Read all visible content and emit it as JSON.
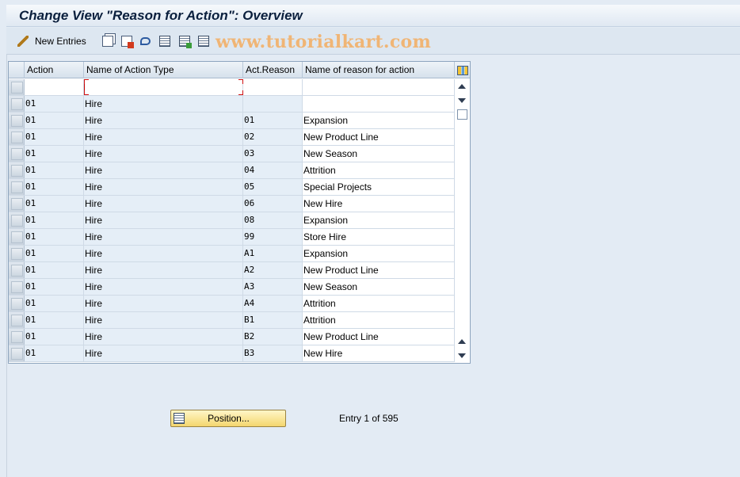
{
  "window": {
    "title": "Change View \"Reason for Action\": Overview"
  },
  "toolbar": {
    "new_entries_label": "New Entries",
    "icons": [
      "edit-toggle-icon",
      "copy-icon",
      "delete-icon",
      "undo-icon",
      "select-all-icon",
      "select-block-icon",
      "deselect-all-icon"
    ]
  },
  "watermark": "www.tutorialkart.com",
  "table": {
    "columns": [
      "Action",
      "Name of Action Type",
      "Act.Reason",
      "Name of reason for action"
    ],
    "rows": [
      {
        "action": "",
        "action_type": "",
        "reason": "",
        "reason_name": ""
      },
      {
        "action": "01",
        "action_type": "Hire",
        "reason": "",
        "reason_name": ""
      },
      {
        "action": "01",
        "action_type": "Hire",
        "reason": "01",
        "reason_name": "Expansion"
      },
      {
        "action": "01",
        "action_type": "Hire",
        "reason": "02",
        "reason_name": "New Product Line"
      },
      {
        "action": "01",
        "action_type": "Hire",
        "reason": "03",
        "reason_name": "New Season"
      },
      {
        "action": "01",
        "action_type": "Hire",
        "reason": "04",
        "reason_name": "Attrition"
      },
      {
        "action": "01",
        "action_type": "Hire",
        "reason": "05",
        "reason_name": "Special Projects"
      },
      {
        "action": "01",
        "action_type": "Hire",
        "reason": "06",
        "reason_name": "New Hire"
      },
      {
        "action": "01",
        "action_type": "Hire",
        "reason": "08",
        "reason_name": "Expansion"
      },
      {
        "action": "01",
        "action_type": "Hire",
        "reason": "99",
        "reason_name": "Store Hire"
      },
      {
        "action": "01",
        "action_type": "Hire",
        "reason": "A1",
        "reason_name": "Expansion"
      },
      {
        "action": "01",
        "action_type": "Hire",
        "reason": "A2",
        "reason_name": "New Product Line"
      },
      {
        "action": "01",
        "action_type": "Hire",
        "reason": "A3",
        "reason_name": "New Season"
      },
      {
        "action": "01",
        "action_type": "Hire",
        "reason": "A4",
        "reason_name": "Attrition"
      },
      {
        "action": "01",
        "action_type": "Hire",
        "reason": "B1",
        "reason_name": "Attrition"
      },
      {
        "action": "01",
        "action_type": "Hire",
        "reason": "B2",
        "reason_name": "New Product Line"
      },
      {
        "action": "01",
        "action_type": "Hire",
        "reason": "B3",
        "reason_name": "New Hire"
      }
    ]
  },
  "footer": {
    "position_button_label": "Position...",
    "entry_info": "Entry 1 of 595"
  }
}
